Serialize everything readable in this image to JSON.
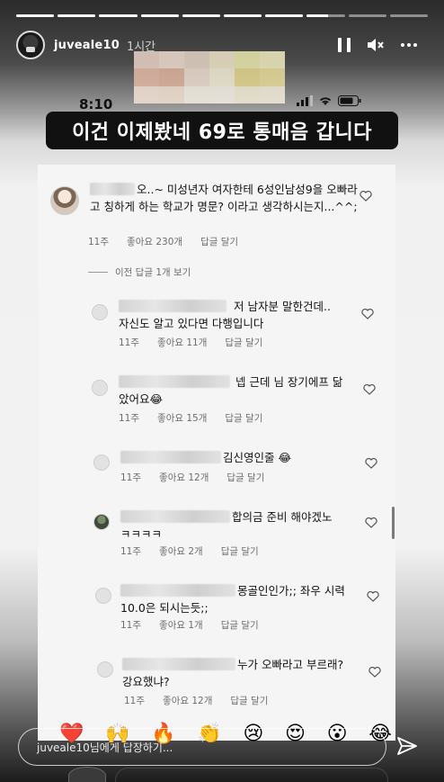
{
  "story": {
    "username": "juveale10",
    "time": "1시간",
    "progress": [
      1,
      1,
      1,
      1,
      1,
      1,
      1,
      0.55,
      0,
      0
    ],
    "caption": "이건 이제봤네 69로 통매음 갑니다",
    "phone_time": "8:10"
  },
  "comments": {
    "view_previous": "이전 답글 1개 보기",
    "items": [
      {
        "text": "오..~ 미성년자 여자한테 6성인남성9을 오빠라고 칭하게 하는 학교가 명문? 이라고 생각하시는지...^^;",
        "age": "11주",
        "likes": "좋아요 230개",
        "reply": "답글 달기"
      },
      {
        "text": "저 남자분 말한건데.. 자신도 알고 있다면 다행입니다",
        "age": "11주",
        "likes": "좋아요 11개",
        "reply": "답글 달기"
      },
      {
        "text": "넵 근데 님 장기에프 닮았어요😂",
        "age": "11주",
        "likes": "좋아요 15개",
        "reply": "답글 달기"
      },
      {
        "text": "김신영인줄 😂",
        "age": "11주",
        "likes": "좋아요 12개",
        "reply": "답글 달기"
      },
      {
        "text": "합의금 준비 해야겠노 ㅋㅋㅋㅋ",
        "age": "11주",
        "likes": "좋아요 2개",
        "reply": "답글 달기"
      },
      {
        "text": "몽골인인가;; 좌우 시력 10.0은 되시는듯;;",
        "age": "11주",
        "likes": "좋아요 1개",
        "reply": "답글 달기"
      },
      {
        "text": "누가 오빠라고 부르래? 강요했냐?",
        "age": "11주",
        "likes": "좋아요 12개",
        "reply": "답글 달기"
      }
    ]
  },
  "reactions": [
    "❤️",
    "🙌",
    "🔥",
    "👏",
    "😢",
    "😍",
    "😮",
    "😂"
  ],
  "reply_bar": {
    "placeholder": "juveale10님에게 답장하기..."
  },
  "icons": {
    "pause": "pause-icon",
    "mute": "mute-icon",
    "more": "more-icon",
    "send": "send-icon",
    "heart": "heart-icon"
  }
}
